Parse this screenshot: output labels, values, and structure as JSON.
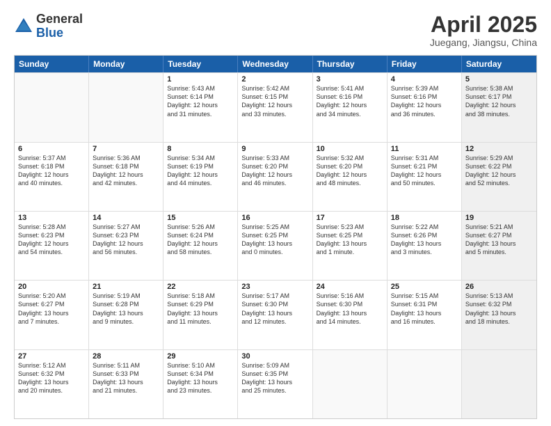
{
  "header": {
    "logo_general": "General",
    "logo_blue": "Blue",
    "month_title": "April 2025",
    "location": "Juegang, Jiangsu, China"
  },
  "weekdays": [
    "Sunday",
    "Monday",
    "Tuesday",
    "Wednesday",
    "Thursday",
    "Friday",
    "Saturday"
  ],
  "rows": [
    [
      {
        "day": "",
        "text": "",
        "empty": true
      },
      {
        "day": "",
        "text": "",
        "empty": true
      },
      {
        "day": "1",
        "text": "Sunrise: 5:43 AM\nSunset: 6:14 PM\nDaylight: 12 hours\nand 31 minutes."
      },
      {
        "day": "2",
        "text": "Sunrise: 5:42 AM\nSunset: 6:15 PM\nDaylight: 12 hours\nand 33 minutes."
      },
      {
        "day": "3",
        "text": "Sunrise: 5:41 AM\nSunset: 6:16 PM\nDaylight: 12 hours\nand 34 minutes."
      },
      {
        "day": "4",
        "text": "Sunrise: 5:39 AM\nSunset: 6:16 PM\nDaylight: 12 hours\nand 36 minutes."
      },
      {
        "day": "5",
        "text": "Sunrise: 5:38 AM\nSunset: 6:17 PM\nDaylight: 12 hours\nand 38 minutes.",
        "shaded": true
      }
    ],
    [
      {
        "day": "6",
        "text": "Sunrise: 5:37 AM\nSunset: 6:18 PM\nDaylight: 12 hours\nand 40 minutes."
      },
      {
        "day": "7",
        "text": "Sunrise: 5:36 AM\nSunset: 6:18 PM\nDaylight: 12 hours\nand 42 minutes."
      },
      {
        "day": "8",
        "text": "Sunrise: 5:34 AM\nSunset: 6:19 PM\nDaylight: 12 hours\nand 44 minutes."
      },
      {
        "day": "9",
        "text": "Sunrise: 5:33 AM\nSunset: 6:20 PM\nDaylight: 12 hours\nand 46 minutes."
      },
      {
        "day": "10",
        "text": "Sunrise: 5:32 AM\nSunset: 6:20 PM\nDaylight: 12 hours\nand 48 minutes."
      },
      {
        "day": "11",
        "text": "Sunrise: 5:31 AM\nSunset: 6:21 PM\nDaylight: 12 hours\nand 50 minutes."
      },
      {
        "day": "12",
        "text": "Sunrise: 5:29 AM\nSunset: 6:22 PM\nDaylight: 12 hours\nand 52 minutes.",
        "shaded": true
      }
    ],
    [
      {
        "day": "13",
        "text": "Sunrise: 5:28 AM\nSunset: 6:23 PM\nDaylight: 12 hours\nand 54 minutes."
      },
      {
        "day": "14",
        "text": "Sunrise: 5:27 AM\nSunset: 6:23 PM\nDaylight: 12 hours\nand 56 minutes."
      },
      {
        "day": "15",
        "text": "Sunrise: 5:26 AM\nSunset: 6:24 PM\nDaylight: 12 hours\nand 58 minutes."
      },
      {
        "day": "16",
        "text": "Sunrise: 5:25 AM\nSunset: 6:25 PM\nDaylight: 13 hours\nand 0 minutes."
      },
      {
        "day": "17",
        "text": "Sunrise: 5:23 AM\nSunset: 6:25 PM\nDaylight: 13 hours\nand 1 minute."
      },
      {
        "day": "18",
        "text": "Sunrise: 5:22 AM\nSunset: 6:26 PM\nDaylight: 13 hours\nand 3 minutes."
      },
      {
        "day": "19",
        "text": "Sunrise: 5:21 AM\nSunset: 6:27 PM\nDaylight: 13 hours\nand 5 minutes.",
        "shaded": true
      }
    ],
    [
      {
        "day": "20",
        "text": "Sunrise: 5:20 AM\nSunset: 6:27 PM\nDaylight: 13 hours\nand 7 minutes."
      },
      {
        "day": "21",
        "text": "Sunrise: 5:19 AM\nSunset: 6:28 PM\nDaylight: 13 hours\nand 9 minutes."
      },
      {
        "day": "22",
        "text": "Sunrise: 5:18 AM\nSunset: 6:29 PM\nDaylight: 13 hours\nand 11 minutes."
      },
      {
        "day": "23",
        "text": "Sunrise: 5:17 AM\nSunset: 6:30 PM\nDaylight: 13 hours\nand 12 minutes."
      },
      {
        "day": "24",
        "text": "Sunrise: 5:16 AM\nSunset: 6:30 PM\nDaylight: 13 hours\nand 14 minutes."
      },
      {
        "day": "25",
        "text": "Sunrise: 5:15 AM\nSunset: 6:31 PM\nDaylight: 13 hours\nand 16 minutes."
      },
      {
        "day": "26",
        "text": "Sunrise: 5:13 AM\nSunset: 6:32 PM\nDaylight: 13 hours\nand 18 minutes.",
        "shaded": true
      }
    ],
    [
      {
        "day": "27",
        "text": "Sunrise: 5:12 AM\nSunset: 6:32 PM\nDaylight: 13 hours\nand 20 minutes."
      },
      {
        "day": "28",
        "text": "Sunrise: 5:11 AM\nSunset: 6:33 PM\nDaylight: 13 hours\nand 21 minutes."
      },
      {
        "day": "29",
        "text": "Sunrise: 5:10 AM\nSunset: 6:34 PM\nDaylight: 13 hours\nand 23 minutes."
      },
      {
        "day": "30",
        "text": "Sunrise: 5:09 AM\nSunset: 6:35 PM\nDaylight: 13 hours\nand 25 minutes."
      },
      {
        "day": "",
        "text": "",
        "empty": true
      },
      {
        "day": "",
        "text": "",
        "empty": true
      },
      {
        "day": "",
        "text": "",
        "empty": true,
        "shaded": true
      }
    ]
  ]
}
